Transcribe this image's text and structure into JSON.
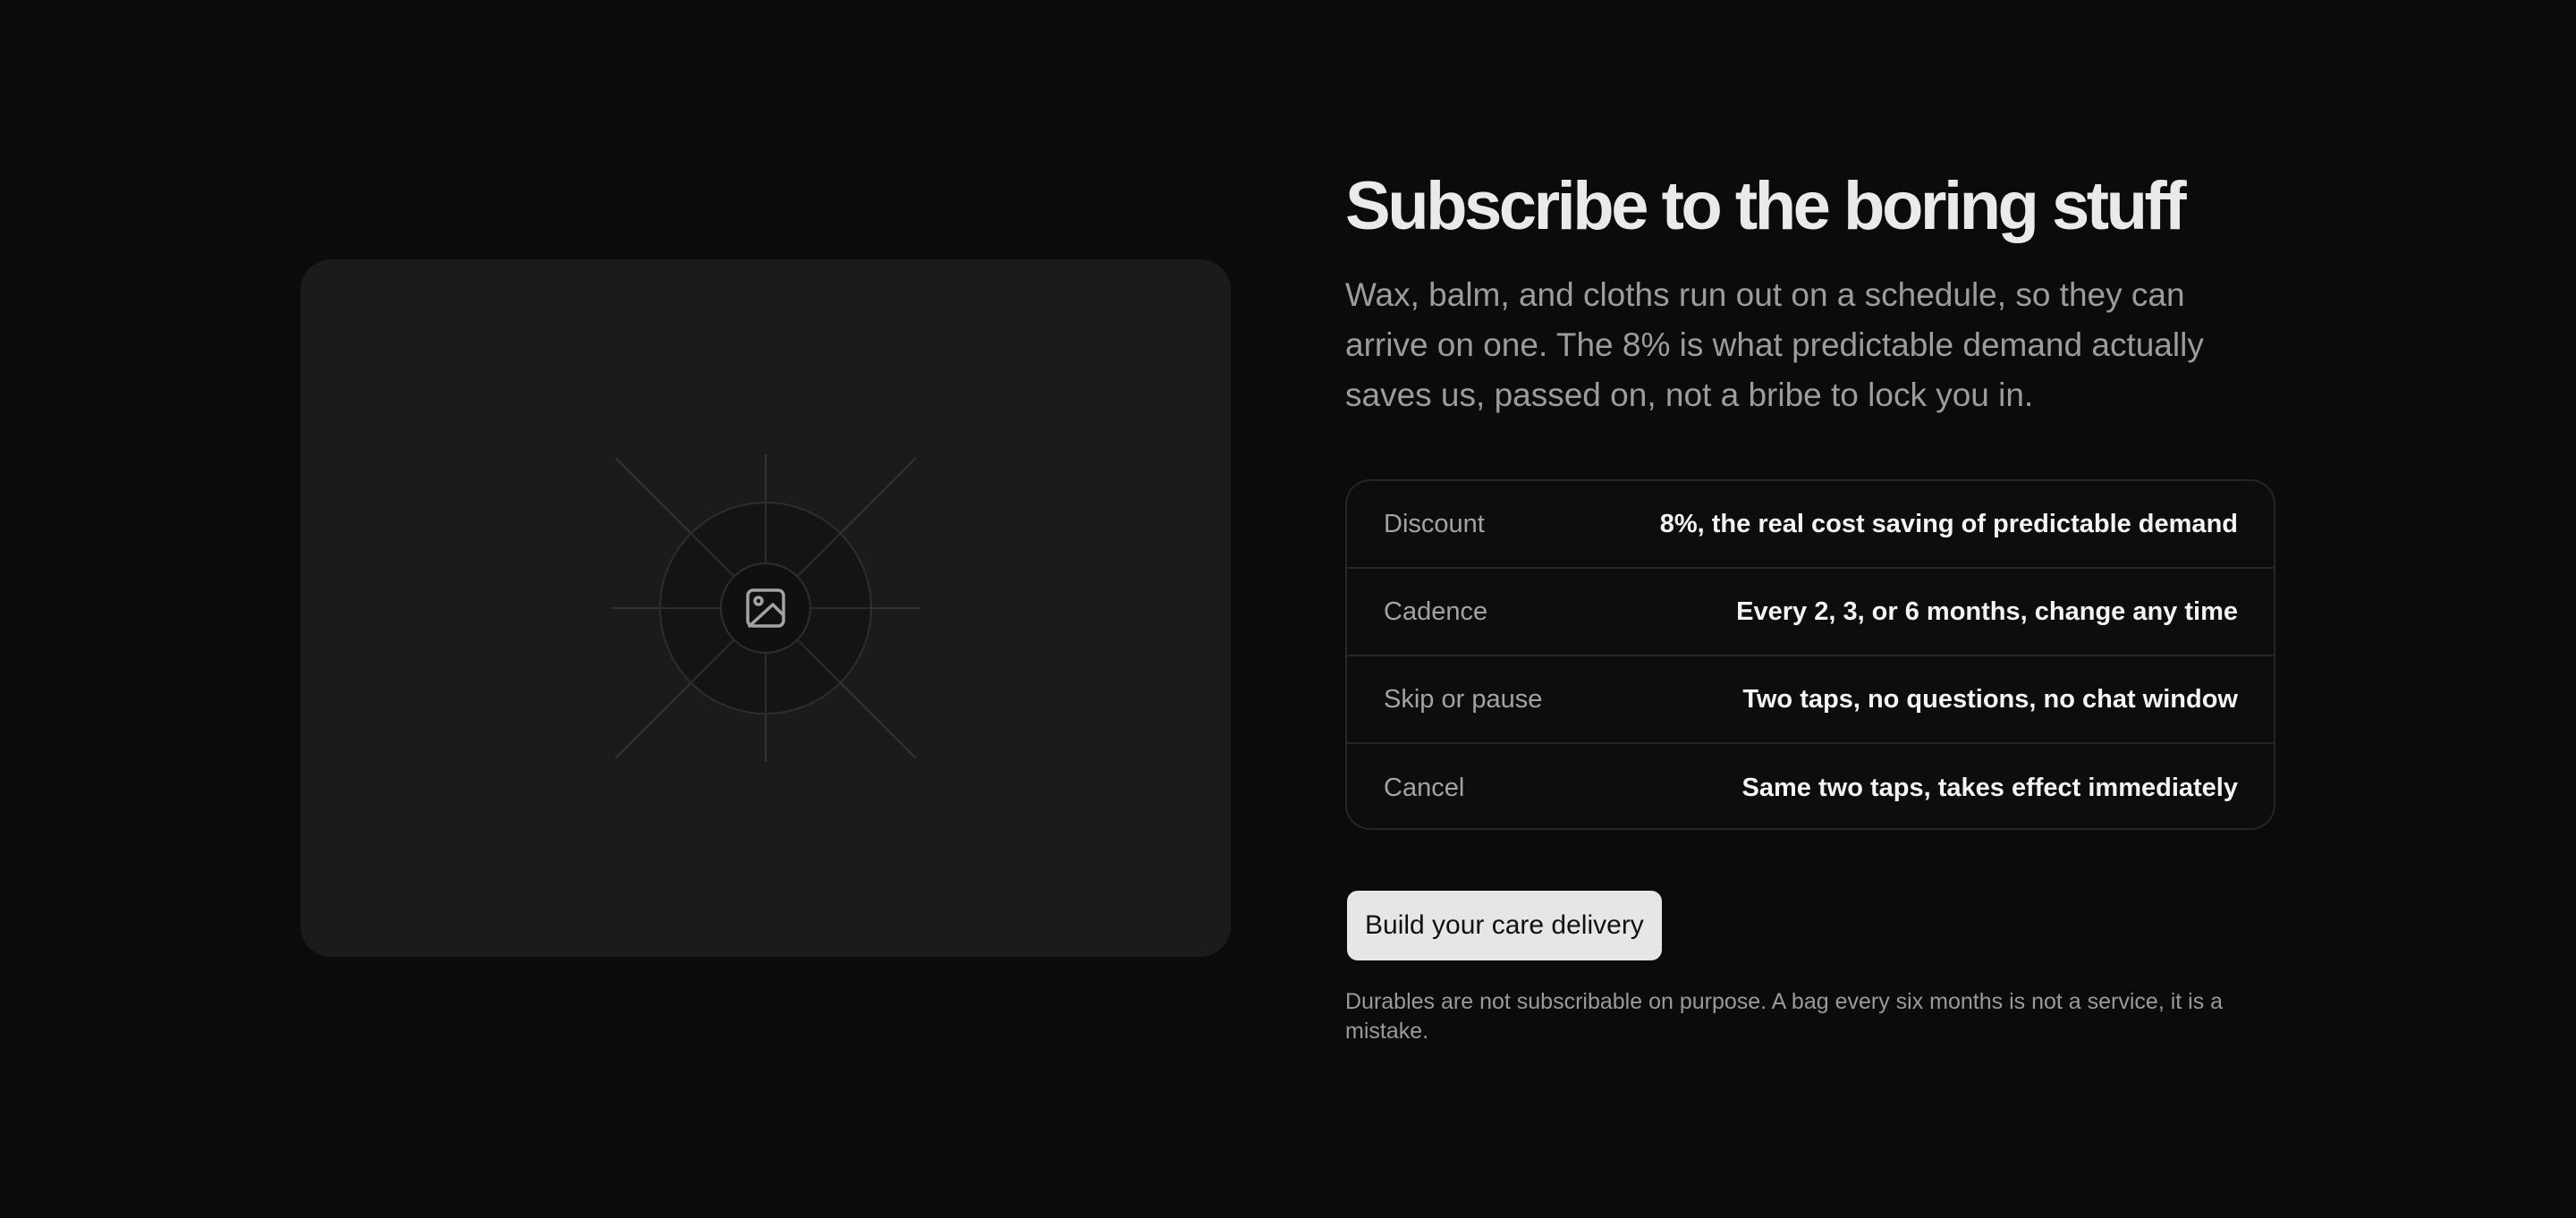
{
  "hero": {
    "image_placeholder_icon": "image-icon"
  },
  "subscription": {
    "title": "Subscribe to the boring stuff",
    "description": "Wax, balm, and cloths run out on a schedule, so they can arrive on one. The 8% is what predictable demand actually saves us, passed on, not a bribe to lock you in.",
    "terms": [
      {
        "label": "Discount",
        "value": "8%, the real cost saving of predictable demand"
      },
      {
        "label": "Cadence",
        "value": "Every 2, 3, or 6 months, change any time"
      },
      {
        "label": "Skip or pause",
        "value": "Two taps, no questions, no chat window"
      },
      {
        "label": "Cancel",
        "value": "Same two taps, takes effect immediately"
      }
    ],
    "cta_label": "Build your care delivery",
    "footnote": "Durables are not subscribable on purpose. A bag every six months is not a service, it is a mistake."
  },
  "colors": {
    "background": "#0b0b0b",
    "card": "#1b1b1b",
    "button": "#e6e6e6"
  }
}
